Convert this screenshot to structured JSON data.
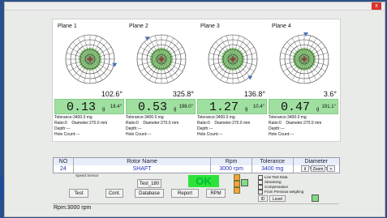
{
  "window": {
    "close_label": "x"
  },
  "planes": [
    {
      "title": "Plane 1",
      "angle_small": "102.6°",
      "value": "0.13",
      "unit": "g",
      "reading_angle": "18.4°",
      "tolerance": "Tolerance:3400.0 mg",
      "ratio": "Ratio:0",
      "diameter": "Diameter:270.0 mm",
      "depth": "Depth:---",
      "holecount": "Hole Count:---"
    },
    {
      "title": "Plane 2",
      "angle_small": "325.8°",
      "value": "0.53",
      "unit": "g",
      "reading_angle": "198.0°",
      "tolerance": "Tolerance:3400.0 mg",
      "ratio": "Ratio:0",
      "diameter": "Diameter:270.0 mm",
      "depth": "Depth:---",
      "holecount": "Hole Count:---"
    },
    {
      "title": "Plane 3",
      "angle_small": "136.8°",
      "value": "1.27",
      "unit": "g",
      "reading_angle": "10.4°",
      "tolerance": "Tolerance:3400.0 mg",
      "ratio": "Ratio:0",
      "diameter": "Diameter:270.0 mm",
      "depth": "Depth:---",
      "holecount": "Hole Count:---"
    },
    {
      "title": "Plane 4",
      "angle_small": "3.6°",
      "value": "0.47",
      "unit": "g",
      "reading_angle": "191.1°",
      "tolerance": "Tolerance:3400.0 mg",
      "ratio": "Ratio:0",
      "diameter": "Diameter:270.0 mm",
      "depth": "Depth:---",
      "holecount": "Hole Count:---"
    }
  ],
  "polar_labels": [
    "0°",
    "30°",
    "60°",
    "90°",
    "120°",
    "150°",
    "180°",
    "210°",
    "240°",
    "270°",
    "300°",
    "330°"
  ],
  "table": {
    "headers": [
      "NO",
      "Rotor Name",
      "Rpm",
      "Tolerance",
      "Diameter"
    ],
    "rows": [
      [
        "24",
        "SHAFT",
        "3000 rpm",
        "3400 mg",
        "270.0 mm"
      ]
    ]
  },
  "buttons": {
    "test": "Test",
    "cont": "Cont.",
    "database": "Database",
    "report": "Report",
    "rpm": "RPM",
    "test180": "Test_180",
    "zoom": "Zoom"
  },
  "status": {
    "ok": "OK",
    "rpm_status": "Rpm:3000 rpm",
    "small_label": "Speed Sensor"
  },
  "options": [
    {
      "label": "Live Test Data",
      "checked": true
    },
    {
      "label": "Streaming",
      "checked": true
    },
    {
      "label": "Compensation",
      "checked": false
    },
    {
      "label": "From Previous weighing",
      "checked": false
    }
  ],
  "side": {
    "id_label": "ID",
    "level_label": "Level"
  },
  "colors": {
    "accent_green": "#2fe23a",
    "readout_green": "#9fe0a0",
    "polar_fill": "#8ecf7e"
  }
}
